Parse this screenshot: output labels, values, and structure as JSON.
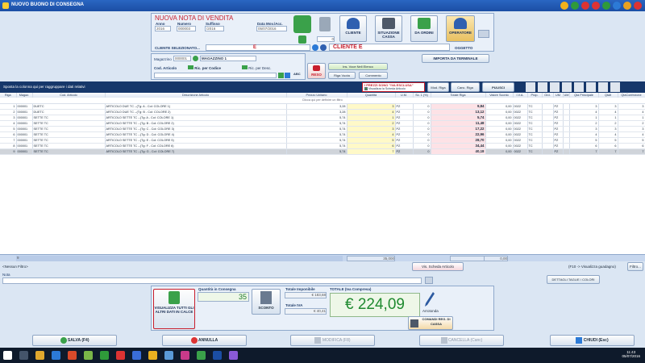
{
  "window": {
    "title": "NUOVO BUONO DI CONSEGNA"
  },
  "header": {
    "doc_title": "NUOVA NOTA DI VENDITA",
    "anno_label": "Anno",
    "anno": "2016",
    "numero_label": "Numero",
    "numero": "000003",
    "suffisso_label": "Suffisso",
    "suffisso": "/2016",
    "data_label": "Data Mov./Acc.",
    "data": "05/07/2016",
    "counter": "0",
    "cliente_btn": "CLIENTE",
    "cassa_btn": "SITUAZIONE CASSA",
    "ordini_btn": "DA ORDINI",
    "operatore_btn": "OPERATORE",
    "oggetto_label": "OGGETTO",
    "cliente_sel_label": "CLIENTE SELEZIONATO...",
    "cliente_code": "E",
    "cliente_name": "CLIENTE E",
    "importa_btn": "IMPORTA DA TERMINALE"
  },
  "filters": {
    "magazzino_label": "Magazzino",
    "magazzino_code": "000001",
    "magazzino_name": "MAGAZZINO 1",
    "cod_articolo_label": "Cod. Articolo",
    "ric_codice": "Ric. per Codice",
    "ric_desc": "Ric. per Desc.",
    "abc": "ABC",
    "reso_btn": "RESO",
    "ins_voce_btn": "Ins. Voce Nell Elenco",
    "riga_vuota_btn": "Riga Vuota",
    "commento_btn": "Commento",
    "iva_notice": "I PREZZI SONO \"IVA ESCLUSA\"",
    "scheda_check": "Visualizza la Scheda Articolo",
    "mod_riga_btn": "Mod. Riga",
    "canc_riga_btn": "Canc. Riga",
    "pulisci_btn": "PULISCI"
  },
  "grid": {
    "group_hint": "Sposta la colonna qui per raggruppare i dati relativi",
    "filter_hint": "Clicca qui per definire un filtro",
    "columns": [
      "Riga",
      "Magaz.",
      "Cod. Articolo",
      "Descrizione Articolo",
      "Prezzo Unitario",
      "Quantità",
      "U.M.",
      "Sc. 1 (%)",
      "Totale Riga",
      "Valore Sconto",
      "I.V.A.",
      "Prop.",
      "Ord.",
      "UM",
      "UM",
      "Qta Principale",
      "Qtalt",
      "QtaConfezione"
    ],
    "rows": [
      [
        "1",
        "000001",
        "DUETC",
        "ARTICOLO DUE TC --(Tg: A - Col: COLORE 1)",
        "3,28",
        "3",
        "PZ",
        "0",
        "9,84",
        "0,00",
        "0022",
        "TC",
        "",
        "PZ",
        "",
        "3",
        "3",
        "3"
      ],
      [
        "2",
        "000001",
        "DUETC",
        "ARTICOLO DUE TC --(Tg: B - Col: COLORE 2)",
        "3,28",
        "4",
        "PZ",
        "0",
        "13,12",
        "0,00",
        "0022",
        "TC",
        "",
        "PZ",
        "",
        "4",
        "4",
        "4"
      ],
      [
        "3",
        "000001",
        "SETTE TC",
        "ARTICOLO SETTE TC --(Tg: A - Col: COLORE 1)",
        "5,74",
        "1",
        "PZ",
        "0",
        "5,74",
        "0,00",
        "0022",
        "TC",
        "",
        "PZ",
        "",
        "1",
        "1",
        "1"
      ],
      [
        "4",
        "000001",
        "SETTE TC",
        "ARTICOLO SETTE TC --(Tg: B - Col: COLORE 2)",
        "5,74",
        "2",
        "PZ",
        "0",
        "11,48",
        "0,00",
        "0022",
        "TC",
        "",
        "PZ",
        "",
        "2",
        "2",
        "2"
      ],
      [
        "5",
        "000001",
        "SETTE TC",
        "ARTICOLO SETTE TC --(Tg: C - Col: COLORE 3)",
        "5,74",
        "3",
        "PZ",
        "0",
        "17,22",
        "0,00",
        "0022",
        "TC",
        "",
        "PZ",
        "",
        "3",
        "3",
        "3"
      ],
      [
        "6",
        "000001",
        "SETTE TC",
        "ARTICOLO SETTE TC --(Tg: D - Col: COLORE 4)",
        "5,74",
        "4",
        "PZ",
        "0",
        "22,96",
        "0,00",
        "0022",
        "TC",
        "",
        "PZ",
        "",
        "4",
        "4",
        "4"
      ],
      [
        "7",
        "000001",
        "SETTE TC",
        "ARTICOLO SETTE TC --(Tg: E - Col: COLORE 5)",
        "5,74",
        "5",
        "PZ",
        "0",
        "28,70",
        "0,00",
        "0022",
        "TC",
        "",
        "PZ",
        "",
        "5",
        "5",
        "5"
      ],
      [
        "8",
        "000001",
        "SETTE TC",
        "ARTICOLO SETTE TC --(Tg: F - Col: COLORE 6)",
        "5,74",
        "6",
        "PZ",
        "0",
        "34,44",
        "0,00",
        "0022",
        "TC",
        "",
        "PZ",
        "",
        "6",
        "6",
        "6"
      ],
      [
        "9",
        "000001",
        "SETTE TC",
        "ARTICOLO SETTE TC --(Tg: G - Col: COLORE 7)",
        "5,74",
        "7",
        "PZ",
        "0",
        "40,18",
        "0,00",
        "0022",
        "TC",
        "",
        "PZ",
        "",
        "7",
        "7",
        "7"
      ]
    ],
    "footer_count": "9",
    "footer_qty": "35,000",
    "footer_total": "183,68",
    "footer_sconto": "0,00"
  },
  "status": {
    "nessun_filtro": "<Nessun Filtro>",
    "vis_scheda_btn": "Vis. Scheda Articolo",
    "f10_hint": "(F10 -> Visualizza guadagno)",
    "filtro_btn": "Filtro...",
    "nota_label": "Nota",
    "dettagli_btn": "DETTAGLI TAGLIE / COLORI"
  },
  "totals": {
    "visualizza_btn": "VISUALIZZA TUTTI GLI ALTRI DATI IN CALCE",
    "qty_label": "Quantità in Consegna",
    "qty": "35",
    "sconto_btn": "SCONTO",
    "imponibile_label": "Totale Imponibile",
    "imponibile": "€ 183,68",
    "iva_label": "Totale IVA",
    "iva": "€ 40,41",
    "totale_label": "TOTALE (Iva Compresa)",
    "totale": "€ 224,09",
    "arrotonda": "Arrotonda",
    "comandi_btn": "COMANDI REG. DI CASSA"
  },
  "footer": {
    "salva": "SALVA (F4)",
    "annulla": "ANNULLA",
    "modifica": "MODIFICA (F8)",
    "cancella": "CANCELLA (Canc)",
    "chiudi": "CHIUDI (Esc)"
  },
  "taskbar": {
    "time": "11:43",
    "date": "05/07/2016"
  }
}
